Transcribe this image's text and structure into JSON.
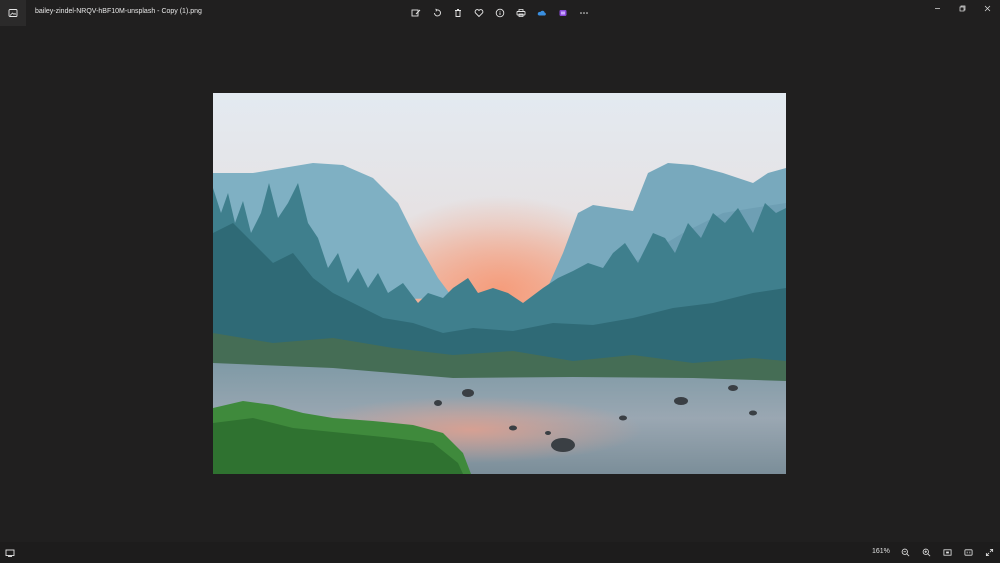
{
  "window": {
    "title": "bailey-zindel-NRQV-hBF10M-unsplash - Copy (1).png",
    "app_icon": "photos-app-icon"
  },
  "toolbar": {
    "buttons": [
      {
        "name": "edit-image-button",
        "icon": "edit-icon"
      },
      {
        "name": "rotate-button",
        "icon": "rotate-icon"
      },
      {
        "name": "delete-button",
        "icon": "trash-icon"
      },
      {
        "name": "favorite-button",
        "icon": "heart-icon"
      },
      {
        "name": "file-info-button",
        "icon": "info-icon"
      },
      {
        "name": "print-button",
        "icon": "printer-icon"
      },
      {
        "name": "onedrive-button",
        "icon": "cloud-icon"
      },
      {
        "name": "clipchamp-button",
        "icon": "clipchamp-icon"
      },
      {
        "name": "more-options-button",
        "icon": "more-icon"
      }
    ]
  },
  "window_controls": [
    "minimize",
    "restore",
    "close"
  ],
  "statusbar": {
    "zoom": "161%",
    "tools": [
      {
        "name": "zoom-out-button",
        "icon": "zoom-out-icon"
      },
      {
        "name": "zoom-in-button",
        "icon": "zoom-in-icon"
      },
      {
        "name": "fit-to-window-button",
        "icon": "fit-icon"
      },
      {
        "name": "actual-size-button",
        "icon": "actual-size-icon"
      },
      {
        "name": "full-screen-button",
        "icon": "fullscreen-icon"
      }
    ]
  },
  "colors": {
    "background": "#201f1f",
    "sky_top": "#dfe7ee",
    "sky_glow": "#f3a07f",
    "mountain": "#6aa2b6",
    "trees": "#2c6c78",
    "grass": "#3f8a3c"
  }
}
